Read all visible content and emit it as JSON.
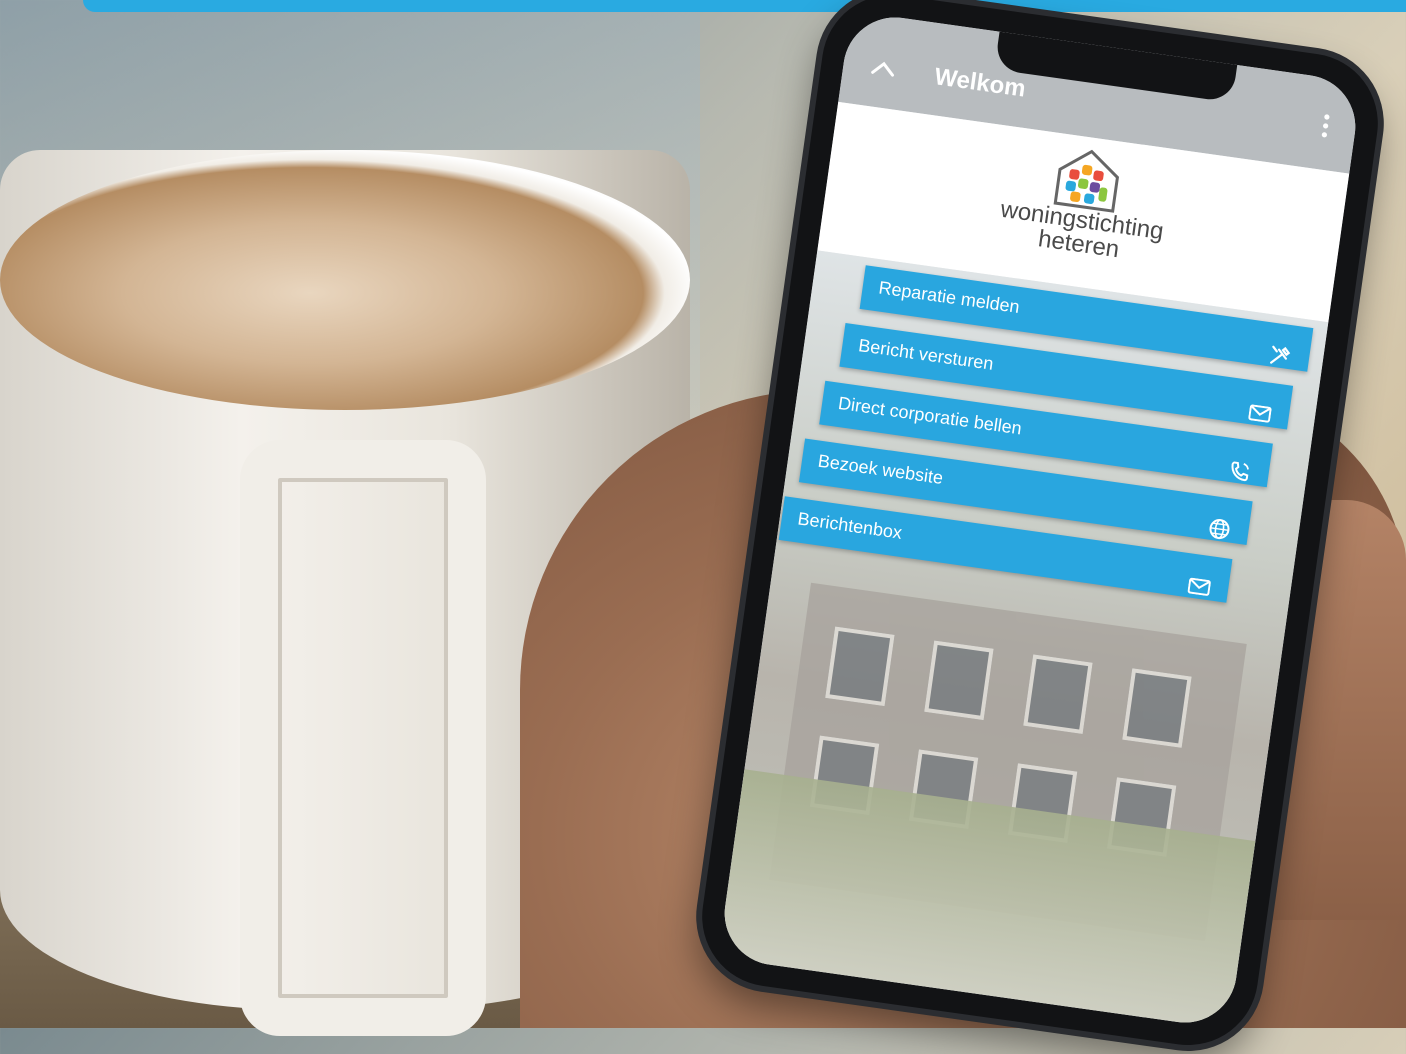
{
  "colors": {
    "accent": "#29aae1",
    "button": "#29a6df",
    "appbar": "#b8bcbf"
  },
  "app": {
    "title": "Welkom",
    "back_icon": "chevron-up-icon",
    "menu_icon": "more-vert-icon"
  },
  "logo": {
    "line1": "woningstichting",
    "line2": "heteren"
  },
  "menu": {
    "items": [
      {
        "label": "Reparatie melden",
        "icon": "tools-icon"
      },
      {
        "label": "Bericht versturen",
        "icon": "mail-icon"
      },
      {
        "label": "Direct corporatie bellen",
        "icon": "phone-icon"
      },
      {
        "label": "Bezoek website",
        "icon": "globe-icon"
      },
      {
        "label": "Berichtenbox",
        "icon": "mail-icon"
      }
    ]
  }
}
